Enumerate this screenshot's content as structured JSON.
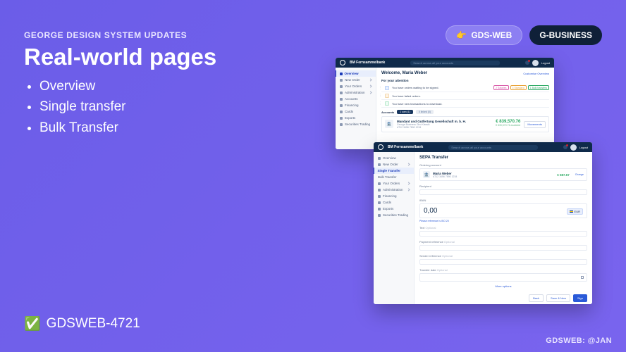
{
  "eyebrow": "GEORGE DESIGN SYSTEM UPDATES",
  "title": "Real-world pages",
  "bullets": [
    "Overview",
    "Single transfer",
    "Bulk Transfer"
  ],
  "tags": {
    "web": {
      "emoji": "👉",
      "label": "GDS-WEB"
    },
    "biz": {
      "label": "G-BUSINESS"
    }
  },
  "ticket": {
    "emoji": "✅",
    "id": "GDSWEB-4721"
  },
  "author": "GDSWEB: @JAN",
  "mock_shared": {
    "brand": "BM Fernsammelbank",
    "search_placeholder": "Search across all your accounts",
    "logout": "Logout"
  },
  "mock_overview": {
    "sidebar": [
      "Overview",
      "New Order",
      "Your Orders",
      "Administration",
      "Accounts",
      "Financing",
      "Cards",
      "Exports",
      "Securities Trading"
    ],
    "active_index": 0,
    "welcome": "Welcome, Maria Weber",
    "customize": "Customise Overview",
    "attention_title": "For your attention",
    "alerts": [
      {
        "text": "You have orders waiting to be signed.",
        "badges": [
          "2 Salaries",
          "3 Standard",
          "1 Bulk transfers"
        ]
      },
      {
        "text": "You have failed orders."
      },
      {
        "text": "You have new transactions to download."
      }
    ],
    "accounts_title": "Accounts",
    "tab_own": "1 own (1)",
    "tab_linked": "0 linked (0)",
    "account": {
      "name": "Mandant und Gutfertung Gesellschaft m. b. H.",
      "bank": "George Business Giro Klassik",
      "iban": "AT12 3456 7890 1234",
      "balance": "€ 839,570.76",
      "avail": "€ 839,570.76 available"
    },
    "movements_btn": "Movements"
  },
  "mock_transfer": {
    "sidebar": [
      "Overview",
      "New Order",
      "Single Transfer",
      "Bulk Transfer",
      "Your Orders",
      "Administration",
      "Financing",
      "Cards",
      "Exports",
      "Securities Trading"
    ],
    "active_index": 2,
    "title": "SEPA Transfer",
    "ordering_label": "Ordering account",
    "ord_name": "Maria Weber",
    "ord_iban": "AT12 3456 7890 1234",
    "ord_balance": "€ 587.67",
    "change": "Change",
    "recipient_label": "Recipient",
    "amount_label": "IBAN",
    "amount_value": "0,00",
    "currency": "EUR",
    "ref_note": "Please reference is ISO 20",
    "text_label": "Text",
    "text_hint": "Optional",
    "payref_label": "Payment reference",
    "payref_hint": "Optional",
    "sendref_label": "Sender reference",
    "sendref_hint": "Optional",
    "date_label": "Transfer date",
    "date_hint": "Optional",
    "more_link": "More options",
    "btn_back": "Back",
    "btn_save": "Save & New",
    "btn_sign": "Sign"
  }
}
